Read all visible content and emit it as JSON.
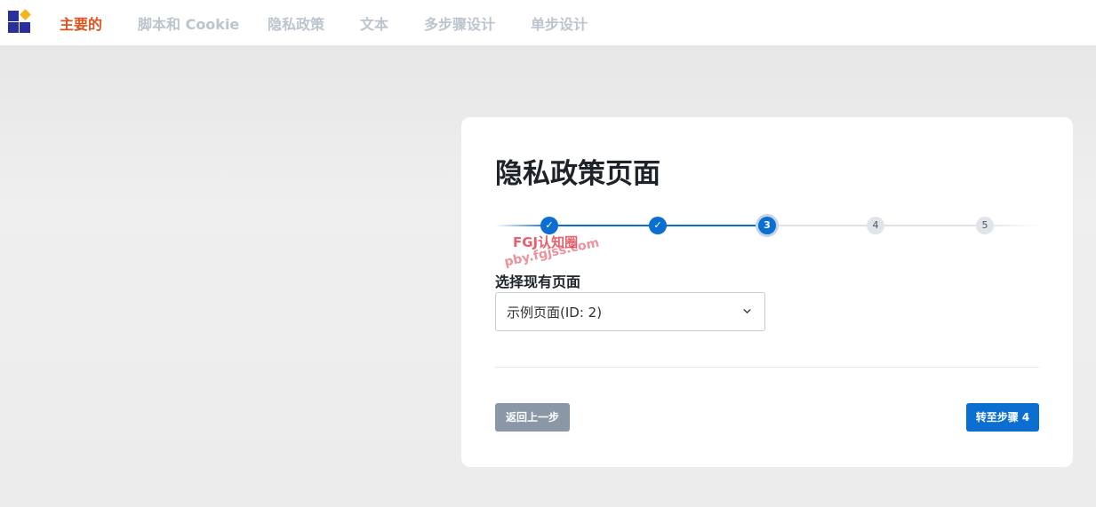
{
  "nav": {
    "items": [
      {
        "label": "主要的",
        "active": true
      },
      {
        "label": "脚本和 Cookie",
        "active": false
      },
      {
        "label": "隐私政策",
        "active": false
      },
      {
        "label": "文本",
        "active": false
      },
      {
        "label": "多步骤设计",
        "active": false
      },
      {
        "label": "单步设计",
        "active": false
      }
    ]
  },
  "card": {
    "title": "隐私政策页面",
    "stepper": {
      "current": 3,
      "total": 5,
      "steps": [
        {
          "label": "✓",
          "state": "done"
        },
        {
          "label": "✓",
          "state": "done"
        },
        {
          "label": "3",
          "state": "current"
        },
        {
          "label": "4",
          "state": "todo"
        },
        {
          "label": "5",
          "state": "todo"
        }
      ]
    },
    "field_label": "选择现有页面",
    "select_value": "示例页面(ID: 2)",
    "back_button": "返回上一步",
    "next_button": "转至步骤 4"
  },
  "watermark": {
    "line1": "FGJ认知圈",
    "line2": "pby.fgjss.com"
  },
  "colors": {
    "accent": "#0a6fd1",
    "active_nav": "#d9541e",
    "inactive_nav": "#bcc4ce",
    "back_button": "#8a97a6"
  }
}
